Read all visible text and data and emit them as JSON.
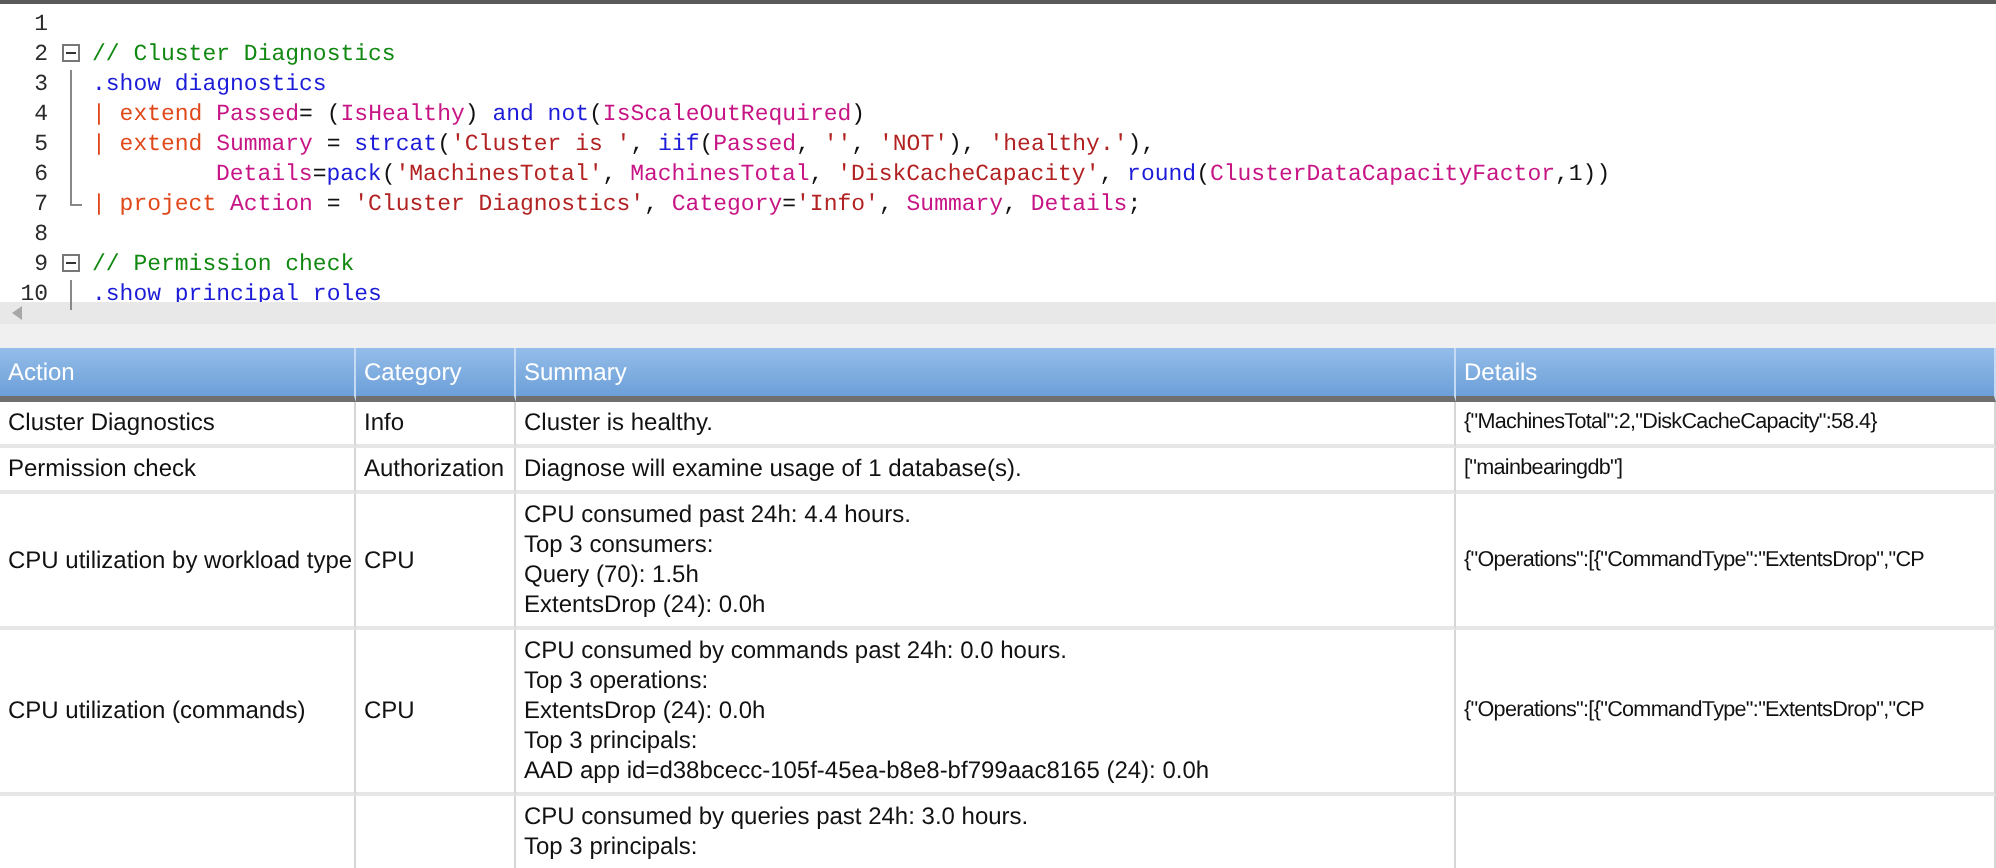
{
  "editor": {
    "lines": [
      {
        "number": "1",
        "kind": "blank"
      },
      {
        "number": "2",
        "kind": "foldstart",
        "tokens": [
          {
            "kind": "comment",
            "text": "// Cluster Diagnostics"
          }
        ]
      },
      {
        "number": "3",
        "kind": "foldbody",
        "tokens": [
          {
            "kind": "keyword",
            "text": ".show diagnostics"
          }
        ]
      },
      {
        "number": "4",
        "kind": "foldbody",
        "tokens": [
          {
            "kind": "operator",
            "text": "| extend "
          },
          {
            "kind": "name",
            "text": "Passed"
          },
          {
            "kind": "plain",
            "text": "= ("
          },
          {
            "kind": "name",
            "text": "IsHealthy"
          },
          {
            "kind": "plain",
            "text": ") "
          },
          {
            "kind": "keyword",
            "text": "and not"
          },
          {
            "kind": "plain",
            "text": "("
          },
          {
            "kind": "name",
            "text": "IsScaleOutRequired"
          },
          {
            "kind": "plain",
            "text": ")"
          }
        ]
      },
      {
        "number": "5",
        "kind": "foldbody",
        "tokens": [
          {
            "kind": "operator",
            "text": "| extend "
          },
          {
            "kind": "name",
            "text": "Summary"
          },
          {
            "kind": "plain",
            "text": " = "
          },
          {
            "kind": "keyword",
            "text": "strcat"
          },
          {
            "kind": "plain",
            "text": "("
          },
          {
            "kind": "string",
            "text": "'Cluster is '"
          },
          {
            "kind": "plain",
            "text": ", "
          },
          {
            "kind": "keyword",
            "text": "iif"
          },
          {
            "kind": "plain",
            "text": "("
          },
          {
            "kind": "name",
            "text": "Passed"
          },
          {
            "kind": "plain",
            "text": ", "
          },
          {
            "kind": "string",
            "text": "''"
          },
          {
            "kind": "plain",
            "text": ", "
          },
          {
            "kind": "string",
            "text": "'NOT'"
          },
          {
            "kind": "plain",
            "text": "), "
          },
          {
            "kind": "string",
            "text": "'healthy.'"
          },
          {
            "kind": "plain",
            "text": "),"
          }
        ]
      },
      {
        "number": "6",
        "kind": "continuation",
        "tokens": [
          {
            "kind": "name",
            "text": "Details"
          },
          {
            "kind": "plain",
            "text": "="
          },
          {
            "kind": "keyword",
            "text": "pack"
          },
          {
            "kind": "plain",
            "text": "("
          },
          {
            "kind": "string",
            "text": "'MachinesTotal'"
          },
          {
            "kind": "plain",
            "text": ", "
          },
          {
            "kind": "name",
            "text": "MachinesTotal"
          },
          {
            "kind": "plain",
            "text": ", "
          },
          {
            "kind": "string",
            "text": "'DiskCacheCapacity'"
          },
          {
            "kind": "plain",
            "text": ", "
          },
          {
            "kind": "keyword",
            "text": "round"
          },
          {
            "kind": "plain",
            "text": "("
          },
          {
            "kind": "name",
            "text": "ClusterDataCapacityFactor"
          },
          {
            "kind": "plain",
            "text": ",1))"
          }
        ]
      },
      {
        "number": "7",
        "kind": "foldend",
        "tokens": [
          {
            "kind": "operator",
            "text": "| project "
          },
          {
            "kind": "name",
            "text": "Action"
          },
          {
            "kind": "plain",
            "text": " = "
          },
          {
            "kind": "string",
            "text": "'Cluster Diagnostics'"
          },
          {
            "kind": "plain",
            "text": ", "
          },
          {
            "kind": "name",
            "text": "Category"
          },
          {
            "kind": "plain",
            "text": "="
          },
          {
            "kind": "string",
            "text": "'Info'"
          },
          {
            "kind": "plain",
            "text": ", "
          },
          {
            "kind": "name",
            "text": "Summary"
          },
          {
            "kind": "plain",
            "text": ", "
          },
          {
            "kind": "name",
            "text": "Details"
          },
          {
            "kind": "plain",
            "text": ";"
          }
        ]
      },
      {
        "number": "8",
        "kind": "blank"
      },
      {
        "number": "9",
        "kind": "foldstart",
        "tokens": [
          {
            "kind": "comment",
            "text": "// Permission check"
          }
        ]
      },
      {
        "number": "10",
        "kind": "foldbody",
        "tokens": [
          {
            "kind": "keyword",
            "text": ".show principal roles"
          }
        ]
      }
    ]
  },
  "table": {
    "columns": [
      "Action",
      "Category",
      "Summary",
      "Details"
    ],
    "rows": [
      {
        "action": "Cluster Diagnostics",
        "category": "Info",
        "summary": [
          "Cluster is healthy."
        ],
        "details": "{\"MachinesTotal\":2,\"DiskCacheCapacity\":58.4}"
      },
      {
        "action": "Permission check",
        "category": "Authorization",
        "summary": [
          "Diagnose will examine usage of 1 database(s)."
        ],
        "details": "[\"mainbearingdb\"]"
      },
      {
        "action": "CPU utilization by workload type",
        "category": "CPU",
        "summary": [
          "CPU consumed past 24h: 4.4 hours.",
          "Top 3 consumers:",
          "Query (70): 1.5h",
          "ExtentsDrop (24): 0.0h"
        ],
        "details": "{\"Operations\":[{\"CommandType\":\"ExtentsDrop\",\"CP"
      },
      {
        "action": "CPU utilization (commands)",
        "category": "CPU",
        "summary": [
          "CPU consumed by commands past 24h: 0.0 hours.",
          "Top 3 operations:",
          "ExtentsDrop (24): 0.0h",
          "Top 3 principals:",
          "AAD app id=d38bcecc-105f-45ea-b8e8-bf799aac8165 (24): 0.0h"
        ],
        "details": "{\"Operations\":[{\"CommandType\":\"ExtentsDrop\",\"CP"
      },
      {
        "summary": [
          "CPU consumed by queries past 24h: 3.0 hours.",
          "Top 3 principals:"
        ]
      }
    ]
  }
}
